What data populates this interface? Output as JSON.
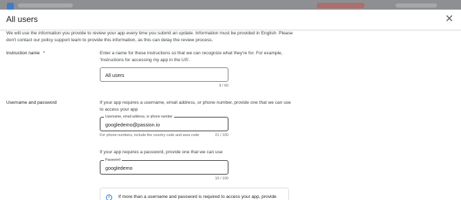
{
  "dialog": {
    "title": "All users",
    "intro": "We will use the information you provide to review your app every time you submit an update. Information must be provided in English. Please don't contact our policy support team to provide this information, as this can delay the review process."
  },
  "instruction_name": {
    "label": "Instruction name",
    "required_mark": "*",
    "help": "Enter a name for these instructions so that we can recognize what they're for. For example, 'Instructions for accessing my app in the US'.",
    "value": "All users",
    "counter": "9 / 60"
  },
  "credentials": {
    "label": "Username and password",
    "username_help": "If your app requires a username, email address, or phone number, provide one that we can use to access your app",
    "username_field_label": "Username, email address, or phone number",
    "username_value": "googledemo@passion.io",
    "username_hint": "For phone numbers, include the country code and area code",
    "username_counter": "21 / 100",
    "password_help": "If your app requires a password, provide one that we can use",
    "password_field_label": "Password",
    "password_value": "googledemo",
    "password_counter": "10 / 100"
  },
  "info": {
    "text": "If more than a username and password is required to access your app, provide"
  },
  "icons": {
    "close": "close-icon",
    "info": "info-icon"
  }
}
